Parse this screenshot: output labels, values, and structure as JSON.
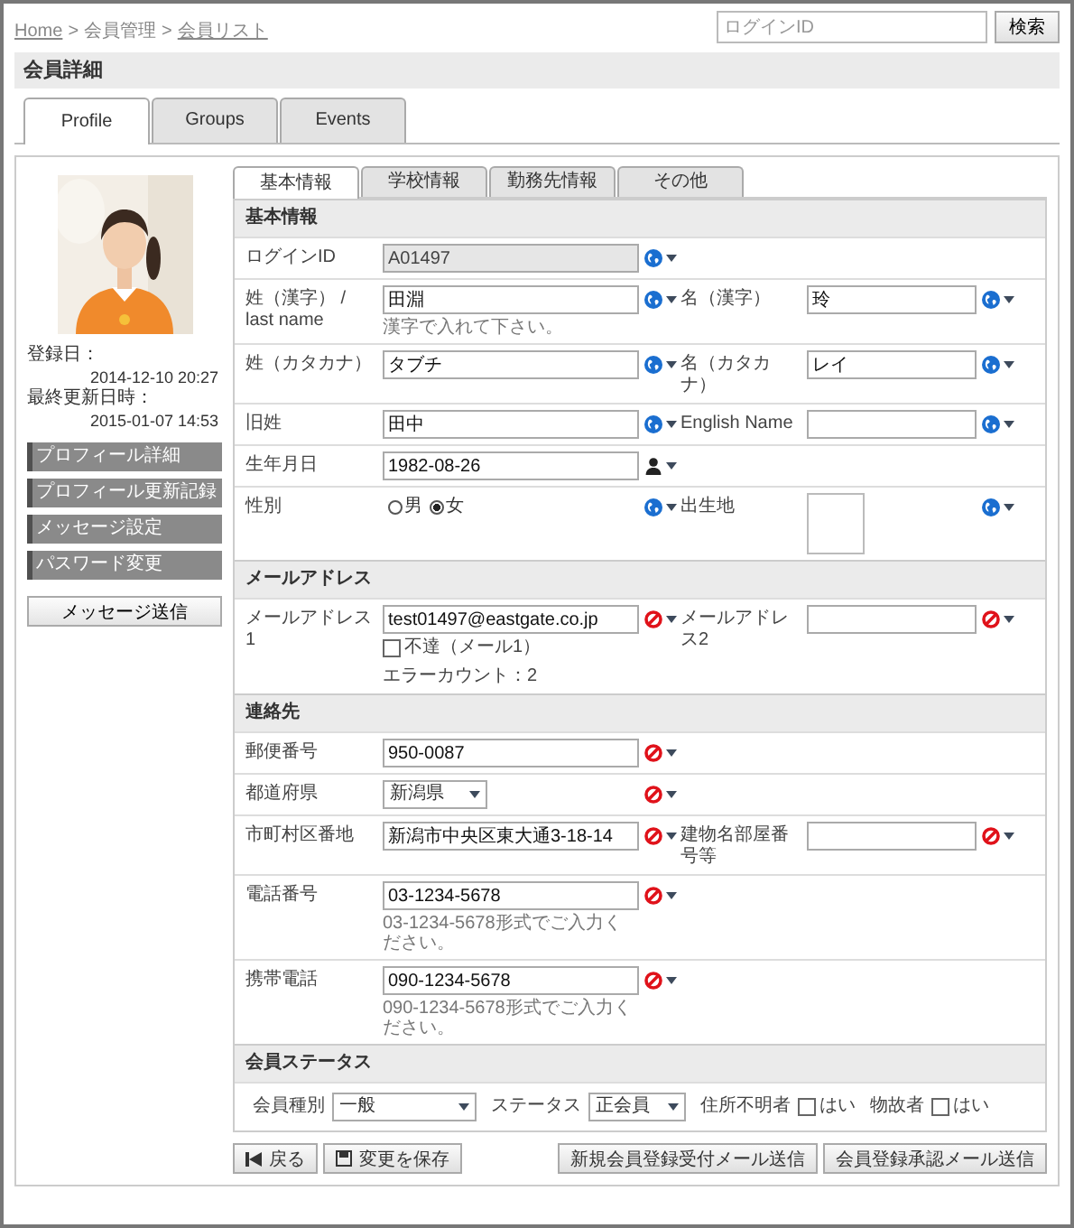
{
  "breadcrumb": [
    {
      "label": "Home",
      "link": true,
      "separator": ">"
    },
    {
      "label": "会員管理",
      "link": false,
      "separator": ">"
    },
    {
      "label": "会員リスト",
      "link": true
    }
  ],
  "search": {
    "placeholder": "ログインID",
    "button": "検索"
  },
  "page_title": "会員詳細",
  "tabs": [
    {
      "label": "Profile",
      "selected": true
    },
    {
      "label": "Groups",
      "selected": false
    },
    {
      "label": "Events",
      "selected": false
    }
  ],
  "sidebar": {
    "info": [
      {
        "label": "登録日：",
        "value": "2014-12-10 20:27"
      },
      {
        "label": "最終更新日時：",
        "value": "2015-01-07 14:53"
      }
    ],
    "menu": [
      "プロフィール詳細",
      "プロフィール更新記録",
      "メッセージ設定",
      "パスワード変更"
    ],
    "button": "メッセージ送信"
  },
  "subtabs": [
    {
      "label": "基本情報",
      "selected": true
    },
    {
      "label": "学校情報",
      "selected": false
    },
    {
      "label": "勤務先情報",
      "selected": false
    },
    {
      "label": "その他",
      "selected": false
    }
  ],
  "sections": [
    {
      "title": "基本情報",
      "rows": [
        {
          "fields": [
            {
              "label": "ログインID",
              "kind": "text",
              "value": "A01497",
              "disabled": true,
              "visibility": {
                "kind": "public"
              }
            }
          ]
        },
        {
          "fields": [
            {
              "label": "姓（漢字） / last name",
              "kind": "text",
              "value": "田淵",
              "disabled": false,
              "hint": "漢字で入れて下さい。",
              "visibility": {
                "kind": "public"
              }
            },
            {
              "label": "名（漢字）",
              "kind": "text",
              "value": "玲",
              "disabled": false,
              "visibility": {
                "kind": "public"
              }
            }
          ]
        },
        {
          "fields": [
            {
              "label": "姓（カタカナ）",
              "kind": "text",
              "value": "タブチ",
              "disabled": false,
              "visibility": {
                "kind": "public"
              }
            },
            {
              "label": "名（カタカナ）",
              "kind": "text",
              "value": "レイ",
              "disabled": false,
              "visibility": {
                "kind": "public"
              }
            }
          ]
        },
        {
          "fields": [
            {
              "label": "旧姓",
              "kind": "text",
              "value": "田中",
              "disabled": false,
              "visibility": {
                "kind": "public"
              }
            },
            {
              "label": "English Name",
              "kind": "text",
              "disabled": false,
              "visibility": {
                "kind": "public"
              }
            }
          ]
        },
        {
          "fields": [
            {
              "label": "生年月日",
              "kind": "text",
              "value": "1982-08-26",
              "disabled": false,
              "visibility": {
                "kind": "members"
              }
            }
          ]
        },
        {
          "fields": [
            {
              "label": "性別",
              "kind": "radio",
              "options": [
                {
                  "label": "男",
                  "selected": false
                },
                {
                  "label": "女",
                  "selected": true
                }
              ],
              "visibility": {
                "kind": "public"
              }
            },
            {
              "label": "出生地",
              "kind": "textarea",
              "visibility": {
                "kind": "public"
              }
            }
          ]
        }
      ]
    },
    {
      "title": "メールアドレス",
      "rows": [
        {
          "fields": [
            {
              "label": "メールアドレス1",
              "kind": "text",
              "value": "test01497@eastgate.co.jp",
              "disabled": false,
              "visibility": {
                "kind": "private"
              },
              "checkbox": {
                "label": "不達（メール1）",
                "checked": false
              },
              "note": "エラーカウント：2"
            },
            {
              "label": "メールアドレス2",
              "kind": "text",
              "disabled": false,
              "visibility": {
                "kind": "private"
              }
            }
          ]
        }
      ]
    },
    {
      "title": "連絡先",
      "rows": [
        {
          "fields": [
            {
              "label": "郵便番号",
              "kind": "text",
              "value": "950-0087",
              "disabled": false,
              "visibility": {
                "kind": "private"
              }
            }
          ]
        },
        {
          "fields": [
            {
              "label": "都道府県",
              "kind": "select",
              "value": "新潟県",
              "visibility": {
                "kind": "private"
              }
            }
          ]
        },
        {
          "fields": [
            {
              "label": "市町村区番地",
              "kind": "text",
              "value": "新潟市中央区東大通3-18-14",
              "disabled": false,
              "visibility": {
                "kind": "private"
              }
            },
            {
              "label": "建物名部屋番号等",
              "kind": "text",
              "disabled": false,
              "visibility": {
                "kind": "private"
              }
            }
          ]
        },
        {
          "fields": [
            {
              "label": "電話番号",
              "kind": "text",
              "value": "03-1234-5678",
              "disabled": false,
              "hint": "03-1234-5678形式でご入力ください。",
              "visibility": {
                "kind": "private"
              }
            }
          ]
        },
        {
          "fields": [
            {
              "label": "携帯電話",
              "kind": "text",
              "value": "090-1234-5678",
              "disabled": false,
              "hint": "090-1234-5678形式でご入力ください。",
              "visibility": {
                "kind": "private"
              }
            }
          ]
        }
      ]
    },
    {
      "title": "会員ステータス",
      "rows": [
        {
          "kind": "inline",
          "fields": [
            {
              "label": "会員種別",
              "kind": "select",
              "value": "一般"
            },
            {
              "label": "ステータス",
              "kind": "select",
              "value": "正会員"
            },
            {
              "label": "住所不明者",
              "kind": "checkbox",
              "option": "はい",
              "checked": false
            },
            {
              "label": "物故者",
              "kind": "checkbox",
              "option": "はい",
              "checked": false
            }
          ]
        }
      ]
    }
  ],
  "actions": {
    "left": [
      {
        "label": "戻る"
      },
      {
        "label": "変更を保存"
      }
    ],
    "right": [
      "新規会員登録受付メール送信",
      "会員登録承認メール送信"
    ]
  }
}
